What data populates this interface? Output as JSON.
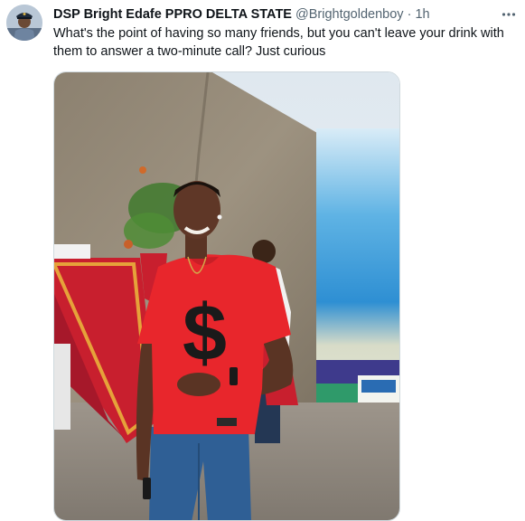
{
  "tweet": {
    "display_name": "DSP Bright Edafe PPRO DELTA STATE",
    "handle": "@Brightgoldenboy",
    "separator": "·",
    "time": "1h",
    "text": "What's the point of having so many friends, but you can't leave your drink with them to answer a two-minute call? Just curious",
    "more_icon": "more-horizontal-icon",
    "media_description_icon": "photo"
  },
  "colors": {
    "text_primary": "#0f1419",
    "text_secondary": "#536471",
    "border": "#cfd9de",
    "shirt_red": "#e8262c",
    "jeans_blue": "#2f5f95"
  }
}
